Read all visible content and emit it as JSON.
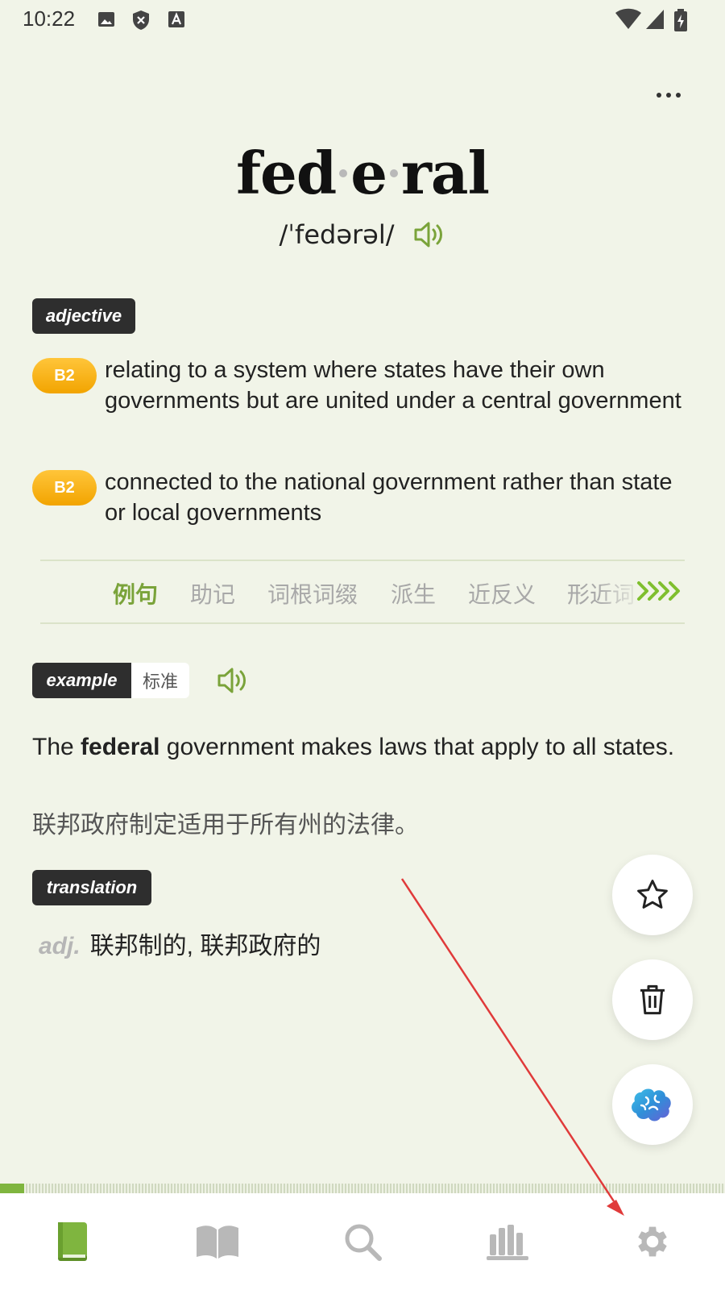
{
  "status_bar": {
    "time": "10:22",
    "left_icons": [
      "image-icon",
      "shield-x-icon",
      "font-a-icon"
    ],
    "right_icons": [
      "wifi-icon",
      "cellular-signal-icon",
      "battery-charging-icon"
    ]
  },
  "entry": {
    "syllables": [
      "fed",
      "e",
      "ral"
    ],
    "phonetic": "/ˈfedərəl/",
    "part_of_speech": "adjective",
    "definitions": [
      {
        "level": "B2",
        "text": "relating to a system where states have their own governments but are united under a central government"
      },
      {
        "level": "B2",
        "text": "connected to the national government rather than state or local governments"
      }
    ]
  },
  "tabs": [
    {
      "label": "例句",
      "active": true
    },
    {
      "label": "助记",
      "active": false
    },
    {
      "label": "词根词缀",
      "active": false
    },
    {
      "label": "派生",
      "active": false
    },
    {
      "label": "近反义",
      "active": false
    },
    {
      "label": "形近词",
      "active": false
    }
  ],
  "example": {
    "tag": "example",
    "variant": "标准",
    "sentence_before": "The ",
    "sentence_bold": "federal",
    "sentence_after": " government makes laws that apply to all states.",
    "translation": "联邦政府制定适用于所有州的法律。"
  },
  "translation": {
    "tag": "translation",
    "pos": "adj.",
    "text": "联邦制的, 联邦政府的"
  },
  "fabs": [
    "star-icon",
    "trash-icon",
    "brain-icon"
  ],
  "progress": {
    "value": 0.033
  },
  "bottom_nav": [
    {
      "name": "nav-learn",
      "icon": "book-icon",
      "active": true
    },
    {
      "name": "nav-dictionary",
      "icon": "open-book-icon",
      "active": false
    },
    {
      "name": "nav-search",
      "icon": "search-icon",
      "active": false
    },
    {
      "name": "nav-stats",
      "icon": "bar-chart-icon",
      "active": false
    },
    {
      "name": "nav-settings",
      "icon": "gear-icon",
      "active": false
    }
  ],
  "colors": {
    "background": "#f1f4e8",
    "accent_green": "#7aa33a",
    "badge_orange": "#f7b21a",
    "tag_dark": "#2e2e2e",
    "annotation_red": "#e03a3a"
  }
}
